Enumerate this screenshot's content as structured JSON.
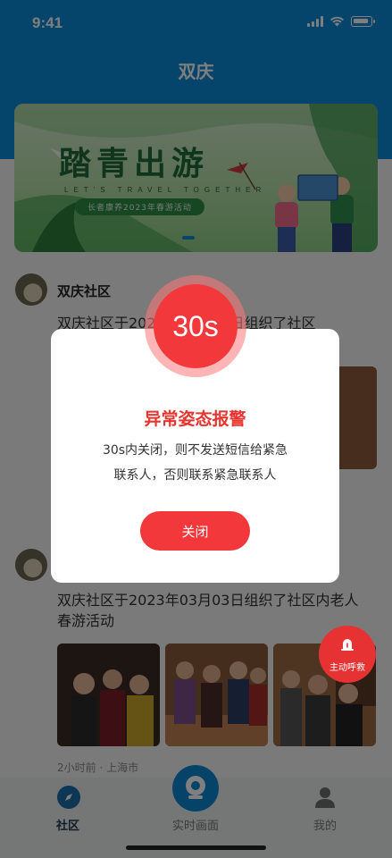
{
  "status_bar": {
    "time": "9:41"
  },
  "header": {
    "title": "双庆"
  },
  "banner": {
    "title": "踏青出游",
    "subtitle_en": "LET'S TRAVEL TOGETHER",
    "pill": "长者康养2023年春游活动"
  },
  "posts": [
    {
      "author": "双庆社区",
      "text": "双庆社区于2023年03月03日组织了社区",
      "meta": ""
    },
    {
      "author": "",
      "text": "双庆社区于2023年03月03日组织了社区内老人春游活动",
      "meta": "2小时前 · 上海市"
    }
  ],
  "modal": {
    "countdown": "30s",
    "title": "异常姿态报警",
    "line1": "30s内关闭，则不发送短信给紧急",
    "line2": "联系人，否则联系紧急联系人",
    "close_label": "关闭"
  },
  "sos": {
    "label": "主动呼救"
  },
  "tabs": [
    {
      "label": "社区",
      "icon": "compass-icon",
      "active": true
    },
    {
      "label": "实时画面",
      "icon": "camera-icon",
      "active": false
    },
    {
      "label": "我的",
      "icon": "user-icon",
      "active": false
    }
  ],
  "colors": {
    "primary": "#0c8ad6",
    "alert": "#f2383b",
    "tab_active": "#1b6fa8"
  }
}
